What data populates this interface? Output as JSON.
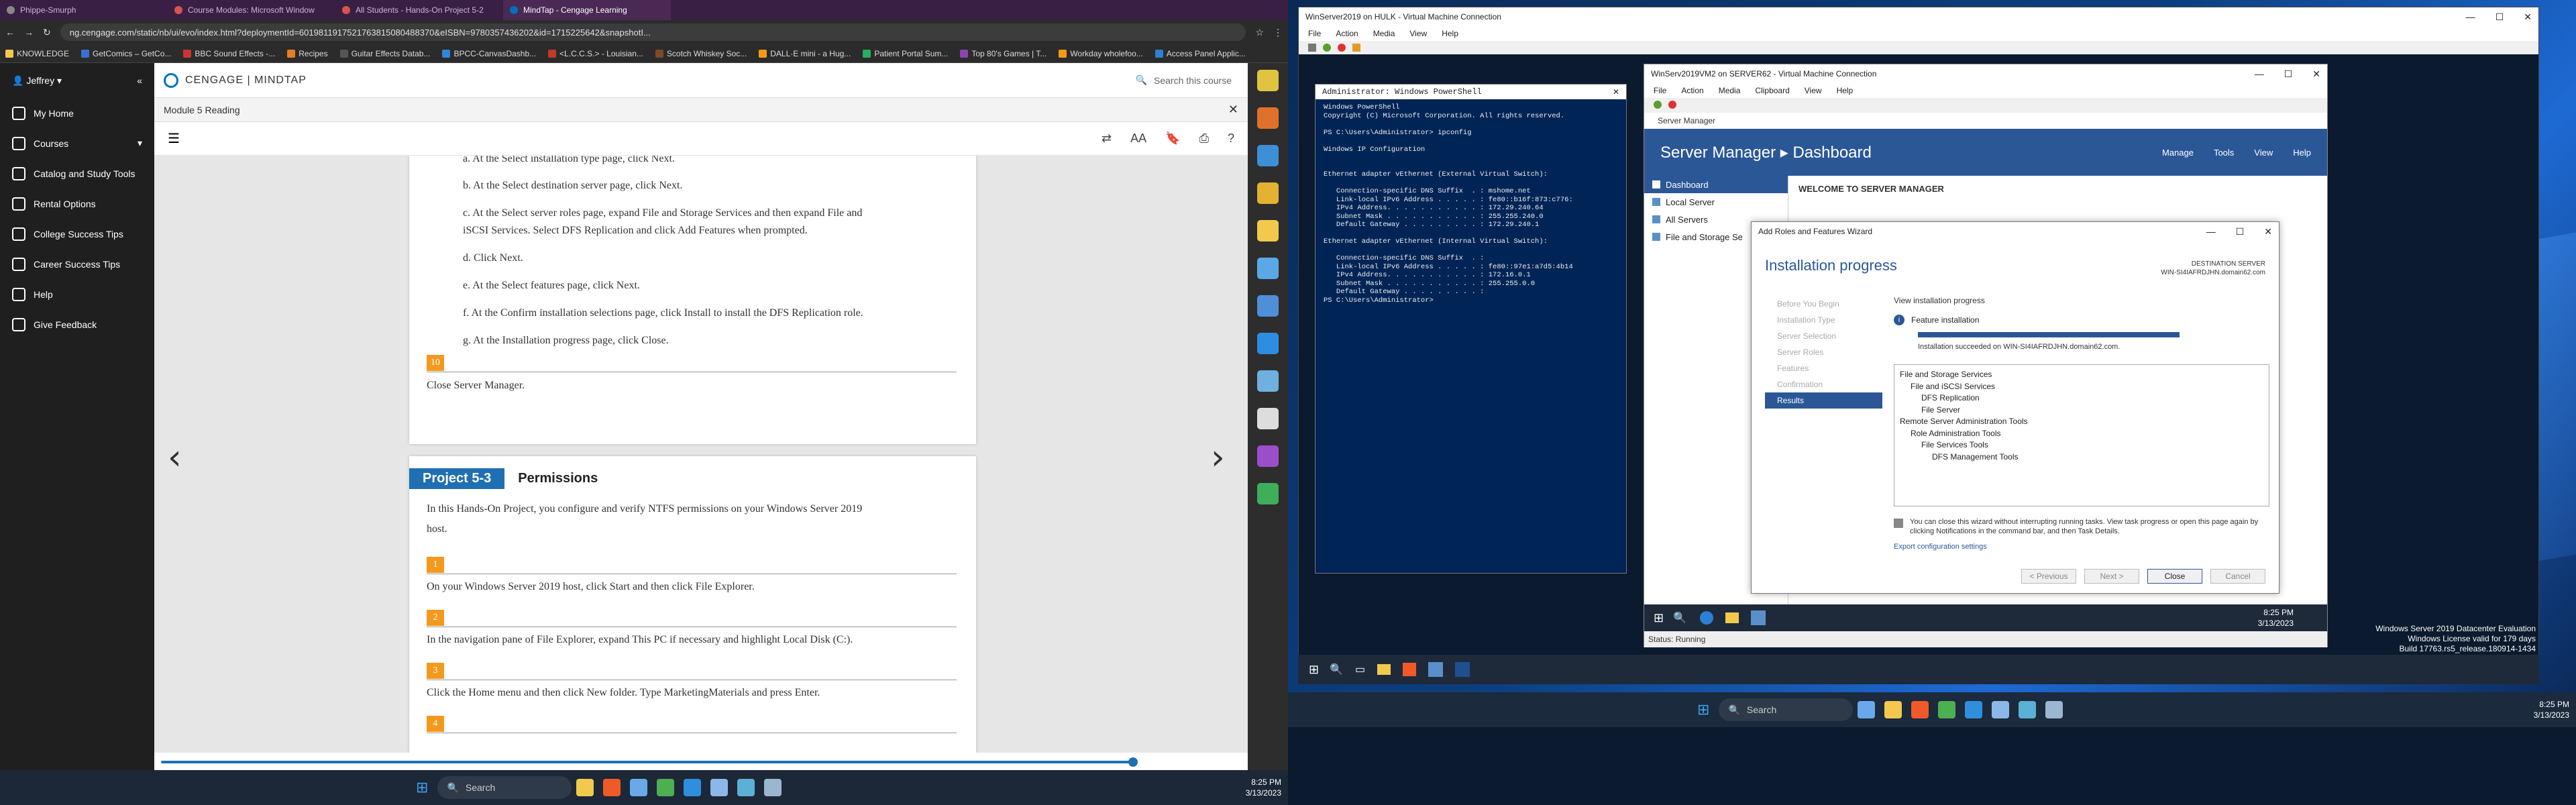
{
  "browser": {
    "tabs": [
      {
        "label": "Phippe-Smurph",
        "color": "#888888"
      },
      {
        "label": "Course Modules: Microsoft Window",
        "color": "#d9534f"
      },
      {
        "label": "All Students - Hands-On Project 5-2",
        "color": "#d9534f"
      },
      {
        "label": "MindTap - Cengage Learning",
        "color": "#0071bc"
      }
    ],
    "url": "ng.cengage.com/static/nb/ui/evo/index.html?deploymentId=6019811917521763815080488370&eISBN=9780357436202&id=1715225642&snapshotI...",
    "bookmarks": [
      "KNOWLEDGE",
      "GetComics – GetCo...",
      "BBC Sound Effects -...",
      "Recipes",
      "Guitar Effects Datab...",
      "BPCC-CanvasDashb...",
      "<L.C.C.S.> - Louisian...",
      "Scotch Whiskey Soc...",
      "DALL·E mini - a Hug...",
      "Patient Portal Sum...",
      "Top 80's Games | T...",
      "Workday wholefoo...",
      "Access Panel Applic..."
    ]
  },
  "sidebar": {
    "user": "Jeffrey",
    "items": [
      "My Home",
      "Courses",
      "Catalog and Study Tools",
      "Rental Options",
      "College Success Tips",
      "Career Success Tips",
      "Help",
      "Give Feedback"
    ]
  },
  "header": {
    "logo": "CENGAGE | MINDTAP",
    "search": "Search this course",
    "module": "Module 5 Reading"
  },
  "page1": {
    "steps": [
      {
        "text": "a. At the Select installation type page, click Next."
      },
      {
        "text": "b. At the Select destination server page, click Next."
      },
      {
        "text": "c. At the Select server roles page, expand File and Storage Services and then expand File and"
      },
      {
        "text": "iSCSI Services. Select DFS Replication and click Add Features when prompted."
      },
      {
        "text": "d. Click Next."
      },
      {
        "text": "e. At the Select features page, click Next."
      },
      {
        "text": "f. At the Confirm installation selections page, click Install to install the DFS Replication role."
      },
      {
        "text": "g. At the Installation progress page, click Close."
      }
    ],
    "step10_num": "10",
    "step10_text": "Close Server Manager."
  },
  "page2": {
    "project_label": "Project 5-3",
    "project_title": "Permissions",
    "intro1": "In this Hands-On Project, you configure and verify NTFS permissions on your Windows Server 2019",
    "intro2": "host.",
    "steps": [
      {
        "num": "1",
        "text": "On your Windows Server 2019 host, click Start and then click File Explorer."
      },
      {
        "num": "2",
        "text": "In the navigation pane of File Explorer, expand This PC if necessary and highlight Local Disk (C:)."
      },
      {
        "num": "3",
        "text": "Click the Home menu and then click New folder. Type MarketingMaterials and press Enter."
      },
      {
        "num": "4",
        "text": ""
      }
    ]
  },
  "reading_progress": 0.9,
  "taskbar_left": {
    "search": "Search",
    "time": "8:25 PM",
    "date": "3/13/2023"
  },
  "vm1": {
    "title": "WinServer2019 on HULK - Virtual Machine Connection",
    "menu": [
      "File",
      "Action",
      "Media",
      "View",
      "Help"
    ]
  },
  "powershell": {
    "title": "Administrator: Windows PowerShell",
    "text": "Windows PowerShell\nCopyright (C) Microsoft Corporation. All rights reserved.\n\nPS C:\\Users\\Administrator> ipconfig\n\nWindows IP Configuration\n\n\nEthernet adapter vEthernet (External Virtual Switch):\n\n   Connection-specific DNS Suffix  . : mshome.net\n   Link-local IPv6 Address . . . . . : fe80::b16f:873:c776:\n   IPv4 Address. . . . . . . . . . . : 172.29.240.64\n   Subnet Mask . . . . . . . . . . . : 255.255.240.0\n   Default Gateway . . . . . . . . . : 172.29.240.1\n\nEthernet adapter vEthernet (Internal Virtual Switch):\n\n   Connection-specific DNS Suffix  . :\n   Link-local IPv6 Address . . . . . : fe80::97e1:a7d5:4b14\n   IPv4 Address. . . . . . . . . . . : 172.16.0.1\n   Subnet Mask . . . . . . . . . . . : 255.255.0.0\n   Default Gateway . . . . . . . . . :\nPS C:\\Users\\Administrator>"
  },
  "vm2": {
    "title": "WinServ2019VM2 on SERVER62 - Virtual Machine Connection",
    "menu": [
      "File",
      "Action",
      "Media",
      "Clipboard",
      "View",
      "Help"
    ],
    "server_manager": "Server Manager",
    "breadcrumb": "Server Manager ▸ Dashboard",
    "top_menu": [
      "Manage",
      "Tools",
      "View",
      "Help"
    ],
    "nav": [
      "Dashboard",
      "Local Server",
      "All Servers",
      "File and Storage Se"
    ],
    "welcome": "WELCOME TO SERVER MANAGER",
    "status": "Status: Running",
    "time": "8:25 PM",
    "date": "3/13/2023"
  },
  "wizard": {
    "title": "Add Roles and Features Wizard",
    "heading": "Installation progress",
    "dest_label": "DESTINATION SERVER",
    "dest_server": "WIN-SI4IAFRDJHN.domain62.com",
    "steps": [
      "Before You Begin",
      "Installation Type",
      "Server Selection",
      "Server Roles",
      "Features",
      "Confirmation",
      "Results"
    ],
    "view_progress": "View installation progress",
    "feature_installation": "Feature installation",
    "progress": 1.0,
    "succeeded": "Installation succeeded on WIN-SI4IAFRDJHN.domain62.com.",
    "tree": [
      "File and Storage Services",
      "File and iSCSI Services",
      "DFS Replication",
      "File Server",
      "Remote Server Administration Tools",
      "Role Administration Tools",
      "File Services Tools",
      "DFS Management Tools"
    ],
    "note": "You can close this wizard without interrupting running tasks. View task progress or open this page again by clicking Notifications in the command bar, and then Task Details.",
    "export": "Export configuration settings",
    "buttons": {
      "previous": "< Previous",
      "next": "Next >",
      "close": "Close",
      "cancel": "Cancel"
    }
  },
  "watermark": {
    "line1": "Windows Server 2019 Datacenter Evaluation",
    "line2": "Windows License valid for 179 days",
    "line3": "Build 17763.rs5_release.180914-1434"
  },
  "taskbar_right": {
    "search": "Search",
    "time": "8:25 PM",
    "date": "3/13/2023"
  }
}
